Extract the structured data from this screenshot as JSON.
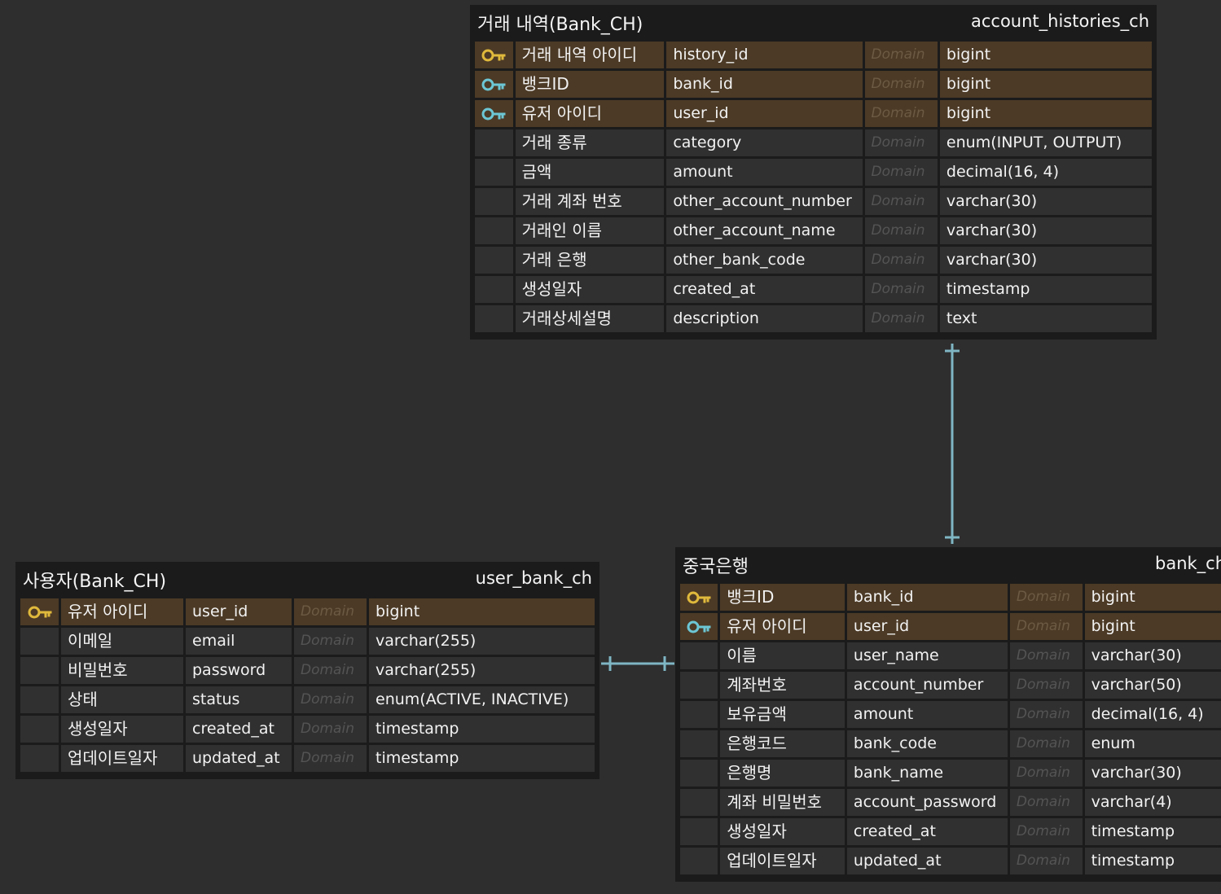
{
  "colors": {
    "background": "#2e2e2e",
    "entity": "#1b1b1b",
    "cell": "#303030",
    "key_row": "#4c3a26",
    "primary_key_icon": "#e0b93c",
    "foreign_key_icon": "#6cc6d4",
    "relationship_line": "#7fb6c4"
  },
  "entities": {
    "history": {
      "logical_name": "거래 내역(Bank_CH)",
      "physical_name": "account_histories_ch",
      "columns": [
        {
          "icon": "primary-key-icon",
          "logical": "거래 내역 아이디",
          "physical": "history_id",
          "domain": "Domain",
          "type": "bigint"
        },
        {
          "icon": "foreign-key-icon",
          "logical": "뱅크ID",
          "physical": "bank_id",
          "domain": "Domain",
          "type": "bigint"
        },
        {
          "icon": "foreign-key-icon",
          "logical": "유저 아이디",
          "physical": "user_id",
          "domain": "Domain",
          "type": "bigint"
        },
        {
          "icon": "",
          "logical": "거래 종류",
          "physical": "category",
          "domain": "Domain",
          "type": "enum(INPUT, OUTPUT)"
        },
        {
          "icon": "",
          "logical": "금액",
          "physical": "amount",
          "domain": "Domain",
          "type": "decimal(16, 4)"
        },
        {
          "icon": "",
          "logical": "거래 계좌 번호",
          "physical": "other_account_number",
          "domain": "Domain",
          "type": "varchar(30)"
        },
        {
          "icon": "",
          "logical": "거래인 이름",
          "physical": "other_account_name",
          "domain": "Domain",
          "type": "varchar(30)"
        },
        {
          "icon": "",
          "logical": "거래 은행",
          "physical": "other_bank_code",
          "domain": "Domain",
          "type": "varchar(30)"
        },
        {
          "icon": "",
          "logical": "생성일자",
          "physical": "created_at",
          "domain": "Domain",
          "type": "timestamp"
        },
        {
          "icon": "",
          "logical": "거래상세설명",
          "physical": "description",
          "domain": "Domain",
          "type": "text"
        }
      ]
    },
    "user": {
      "logical_name": "사용자(Bank_CH)",
      "physical_name": "user_bank_ch",
      "columns": [
        {
          "icon": "primary-key-icon",
          "logical": "유저 아이디",
          "physical": "user_id",
          "domain": "Domain",
          "type": "bigint"
        },
        {
          "icon": "",
          "logical": "이메일",
          "physical": "email",
          "domain": "Domain",
          "type": "varchar(255)"
        },
        {
          "icon": "",
          "logical": "비밀번호",
          "physical": "password",
          "domain": "Domain",
          "type": "varchar(255)"
        },
        {
          "icon": "",
          "logical": "상태",
          "physical": "status",
          "domain": "Domain",
          "type": "enum(ACTIVE, INACTIVE)"
        },
        {
          "icon": "",
          "logical": "생성일자",
          "physical": "created_at",
          "domain": "Domain",
          "type": "timestamp"
        },
        {
          "icon": "",
          "logical": "업데이트일자",
          "physical": "updated_at",
          "domain": "Domain",
          "type": "timestamp"
        }
      ]
    },
    "bank": {
      "logical_name": "중국은행",
      "physical_name": "bank_ch",
      "columns": [
        {
          "icon": "primary-key-icon",
          "logical": "뱅크ID",
          "physical": "bank_id",
          "domain": "Domain",
          "type": "bigint"
        },
        {
          "icon": "foreign-key-icon",
          "logical": "유저 아이디",
          "physical": "user_id",
          "domain": "Domain",
          "type": "bigint"
        },
        {
          "icon": "",
          "logical": "이름",
          "physical": "user_name",
          "domain": "Domain",
          "type": "varchar(30)"
        },
        {
          "icon": "",
          "logical": "계좌번호",
          "physical": "account_number",
          "domain": "Domain",
          "type": "varchar(50)"
        },
        {
          "icon": "",
          "logical": "보유금액",
          "physical": "amount",
          "domain": "Domain",
          "type": "decimal(16, 4)"
        },
        {
          "icon": "",
          "logical": "은행코드",
          "physical": "bank_code",
          "domain": "Domain",
          "type": "enum"
        },
        {
          "icon": "",
          "logical": "은행명",
          "physical": "bank_name",
          "domain": "Domain",
          "type": "varchar(30)"
        },
        {
          "icon": "",
          "logical": "계좌 비밀번호",
          "physical": "account_password",
          "domain": "Domain",
          "type": "varchar(4)"
        },
        {
          "icon": "",
          "logical": "생성일자",
          "physical": "created_at",
          "domain": "Domain",
          "type": "timestamp"
        },
        {
          "icon": "",
          "logical": "업데이트일자",
          "physical": "updated_at",
          "domain": "Domain",
          "type": "timestamp"
        }
      ]
    }
  },
  "relationships": [
    {
      "from": "history",
      "to": "bank",
      "cardinality": "one-to-one"
    },
    {
      "from": "user",
      "to": "bank",
      "cardinality": "one-to-one"
    }
  ]
}
